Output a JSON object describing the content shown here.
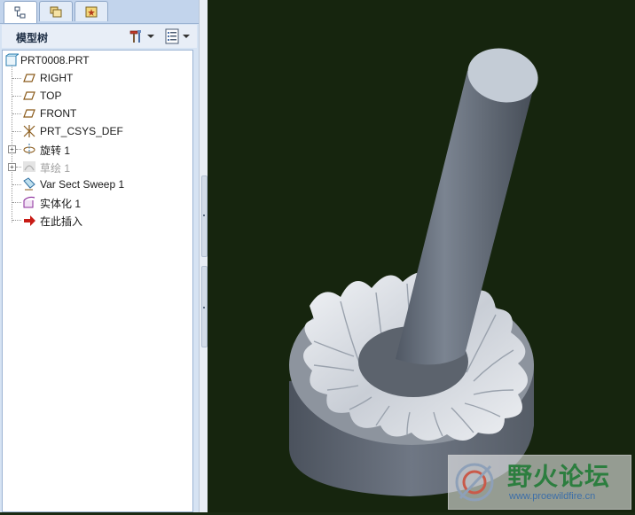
{
  "panel": {
    "title": "模型树"
  },
  "tree": {
    "items": [
      {
        "label": "PRT0008.PRT",
        "icon": "part-icon"
      },
      {
        "label": "RIGHT",
        "icon": "datum-plane-icon"
      },
      {
        "label": "TOP",
        "icon": "datum-plane-icon"
      },
      {
        "label": "FRONT",
        "icon": "datum-plane-icon"
      },
      {
        "label": "PRT_CSYS_DEF",
        "icon": "coordinate-system-icon"
      },
      {
        "label": "旋转 1",
        "icon": "revolve-icon"
      },
      {
        "label": "草绘 1",
        "icon": "sketch-icon"
      },
      {
        "label": "Var Sect Sweep 1",
        "icon": "var-sect-sweep-icon"
      },
      {
        "label": "实体化 1",
        "icon": "solidify-icon"
      },
      {
        "label": "在此插入",
        "icon": "insert-here-arrow-icon"
      }
    ]
  },
  "watermark": {
    "title": "野火论坛",
    "url": "www.proewildfire.cn"
  },
  "colors": {
    "viewport_background": "#16250e",
    "model_gray": "#6f7784",
    "tree_panel": "#d6e3f3"
  }
}
